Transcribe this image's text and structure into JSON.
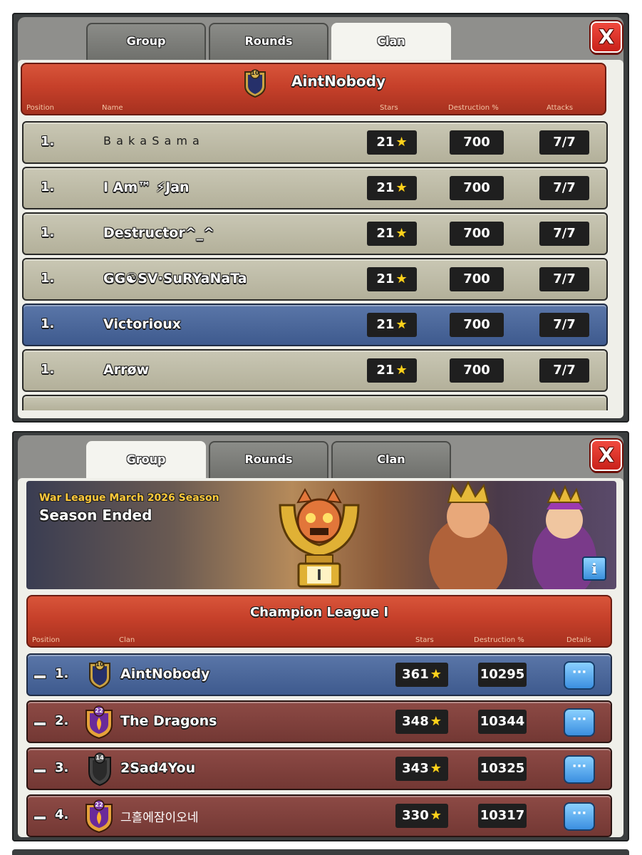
{
  "top_panel": {
    "tabs": [
      {
        "label": "Group"
      },
      {
        "label": "Rounds"
      },
      {
        "label": "Clan"
      }
    ],
    "close_label": "X",
    "clan_name": "AintNobody",
    "clan_badge_level": "10",
    "columns": {
      "position": "Position",
      "name": "Name",
      "stars": "Stars",
      "destruction": "Destruction %",
      "attacks": "Attacks"
    },
    "rows": [
      {
        "position": "1.",
        "name": "B a k a S a m a",
        "stars": "21",
        "destruction": "700",
        "attacks": "7/7"
      },
      {
        "position": "1.",
        "name": "I Am™ ⚡Jan",
        "stars": "21",
        "destruction": "700",
        "attacks": "7/7"
      },
      {
        "position": "1.",
        "name": "Destructor^_^",
        "stars": "21",
        "destruction": "700",
        "attacks": "7/7"
      },
      {
        "position": "1.",
        "name": "GG☯SV·SuRYaNaTa",
        "stars": "21",
        "destruction": "700",
        "attacks": "7/7"
      },
      {
        "position": "1.",
        "name": "Victorioux",
        "stars": "21",
        "destruction": "700",
        "attacks": "7/7",
        "highlighted": true
      },
      {
        "position": "1.",
        "name": "Arrøw",
        "stars": "21",
        "destruction": "700",
        "attacks": "7/7"
      }
    ]
  },
  "bottom_panel": {
    "tabs": [
      {
        "label": "Group"
      },
      {
        "label": "Rounds"
      },
      {
        "label": "Clan"
      }
    ],
    "close_label": "X",
    "banner": {
      "season_title": "War League March 2026 Season",
      "status": "Season Ended",
      "trophy_numeral": "I",
      "info_icon": "i"
    },
    "league_name": "Champion League I",
    "columns": {
      "position": "Position",
      "clan": "Clan",
      "stars": "Stars",
      "destruction": "Destruction %",
      "details": "Details"
    },
    "rows": [
      {
        "position": "1.",
        "badge_level": "10",
        "name": "AintNobody",
        "stars": "361",
        "destruction": "10295",
        "details": "···",
        "highlighted": true
      },
      {
        "position": "2.",
        "badge_level": "22",
        "name": "The Dragons",
        "stars": "348",
        "destruction": "10344",
        "details": "···"
      },
      {
        "position": "3.",
        "badge_level": "14",
        "name": "2Sad4You",
        "stars": "343",
        "destruction": "10325",
        "details": "···"
      },
      {
        "position": "4.",
        "badge_level": "22",
        "name": "그홀에잠이오네",
        "stars": "330",
        "destruction": "10317",
        "details": "···"
      }
    ]
  },
  "colors": {
    "accent_red": "#c6402a",
    "highlight_blue": "#3e5a8e",
    "star_gold": "#ffd21c",
    "button_blue": "#3b8fe0"
  }
}
